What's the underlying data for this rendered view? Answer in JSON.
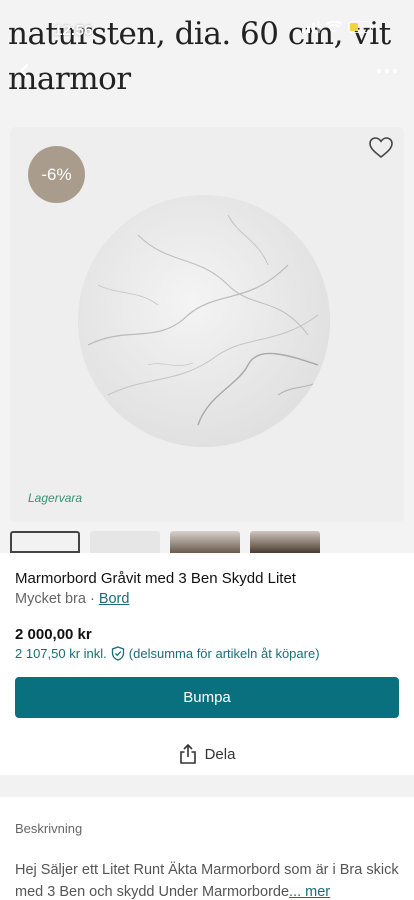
{
  "background": {
    "title_text": "natursten, dia. 60 cm, vit marmor"
  },
  "status_bar": {
    "time": "12:56"
  },
  "listing": {
    "discount_badge": "-6%",
    "stock_label": "Lagervara",
    "title": "Marmorbord Gråvit med 3 Ben Skydd Litet",
    "condition": "Mycket bra",
    "separator": " · ",
    "category": "Bord",
    "price": "2 000,00 kr",
    "price_incl": "2 107,50 kr inkl.",
    "protection_text": "(delsumma för artikeln åt köpare)"
  },
  "actions": {
    "bump_label": "Bumpa",
    "share_label": "Dela"
  },
  "description": {
    "label": "Beskrivning",
    "text": "Hej Säljer ett Litet Runt Äkta Marmorbord som är i Bra skick med 3 Ben och skydd Under Marmorborde",
    "more_label": "... mer"
  },
  "colors": {
    "accent": "#09717d",
    "link": "#1a6d79",
    "badge": "#a99c8d",
    "stock": "#3b8f74"
  },
  "icons": [
    "back-arrow-icon",
    "more-dots-icon",
    "heart-icon",
    "shield-check-icon",
    "share-icon"
  ]
}
